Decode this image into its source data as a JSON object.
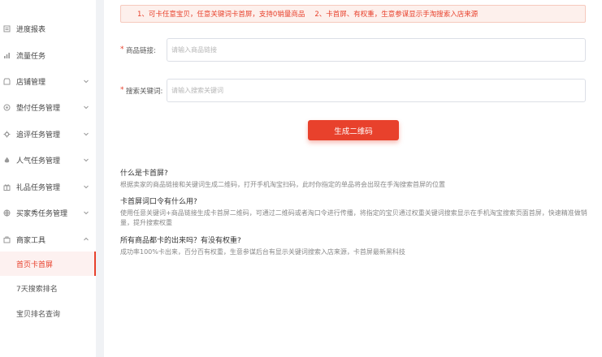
{
  "sidebar": {
    "items": [
      {
        "label": "进度报表",
        "icon": "report-icon",
        "has_arrow": false
      },
      {
        "label": "流量任务",
        "icon": "chart-icon",
        "has_arrow": false
      },
      {
        "label": "店铺管理",
        "icon": "store-icon",
        "has_arrow": true
      },
      {
        "label": "垫付任务管理",
        "icon": "box-icon",
        "has_arrow": true
      },
      {
        "label": "追评任务管理",
        "icon": "gear-icon",
        "has_arrow": true
      },
      {
        "label": "人气任务管理",
        "icon": "flame-icon",
        "has_arrow": true
      },
      {
        "label": "礼品任务管理",
        "icon": "gift-icon",
        "has_arrow": true
      },
      {
        "label": "买家秀任务管理",
        "icon": "globe-icon",
        "has_arrow": true
      },
      {
        "label": "商家工具",
        "icon": "tools-icon",
        "has_arrow": true,
        "expanded": true
      }
    ],
    "subitems": [
      {
        "label": "首页卡首屏",
        "active": true
      },
      {
        "label": "7天搜索排名",
        "active": false
      },
      {
        "label": "宝贝排名查询",
        "active": false
      }
    ]
  },
  "notice": {
    "text1": "1、可卡任意宝贝，任意关键词卡首屏，支持0销量商品",
    "text2": "2、卡首屏、有权重，生意参谋显示手淘搜索入店来源"
  },
  "form": {
    "link_label": "商品链接:",
    "link_placeholder": "请输入商品链接",
    "keyword_label": "搜索关键词:",
    "keyword_placeholder": "请输入搜索关键词",
    "required_mark": "*",
    "submit_label": "生成二维码"
  },
  "faq": [
    {
      "q": "什么是卡首屏?",
      "a": "根据卖家的商品链接和关键词生成二维码，打开手机淘宝扫码，此时你指定的单品将会出现在手淘搜索首屏的位置"
    },
    {
      "q": "卡首屏词口令有什么用?",
      "a": "使用任意关键词+商品链接生成卡首屏二维码，可通过二维码或者淘口令进行传播，将指定的宝贝通过权重关键词搜索显示在手机淘宝搜索页面首屏，快速精准做销量，提升搜索权重"
    },
    {
      "q": "所有商品都卡的出来吗？有没有权重?",
      "a": "成功率100%卡出来，百分百有权重，生意参谋后台有显示关键词搜索入店来源，卡首屏最新黑科技"
    }
  ],
  "colors": {
    "accent": "#e8412c",
    "notice_bg": "#fdf0ec"
  }
}
